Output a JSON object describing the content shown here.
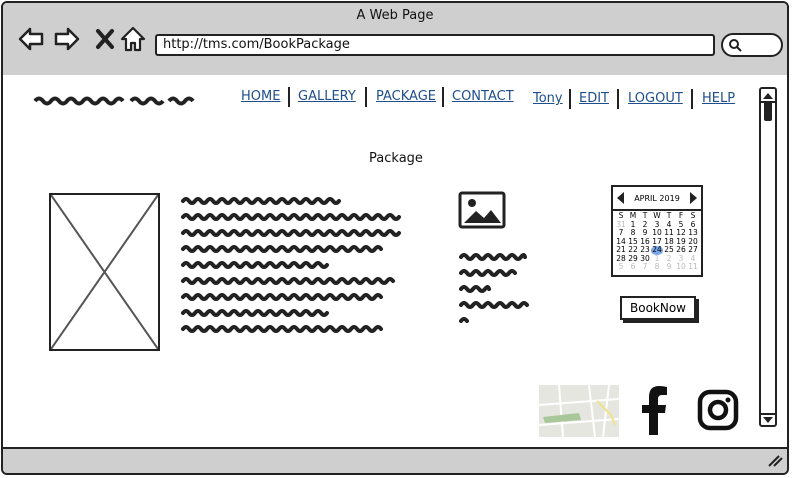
{
  "window": {
    "title": "A Web Page"
  },
  "browser": {
    "url": "http://tms.com/BookPackage"
  },
  "nav": {
    "home": "HOME",
    "gallery": "GALLERY",
    "package": "PACKAGE",
    "contact": "CONTACT",
    "user": "Tony",
    "edit": "EDIT",
    "logout": "LOGOUT",
    "help": "HELP"
  },
  "page": {
    "title": "Package"
  },
  "calendar": {
    "month": "APRIL 2019",
    "weekdays": [
      "S",
      "M",
      "T",
      "W",
      "T",
      "F",
      "S"
    ],
    "selected_day": "24"
  },
  "actions": {
    "book_now": "BookNow"
  },
  "icons": [
    "back-arrow-icon",
    "forward-arrow-icon",
    "close-icon",
    "home-icon",
    "search-icon",
    "image-icon",
    "facebook-icon",
    "instagram-icon"
  ]
}
